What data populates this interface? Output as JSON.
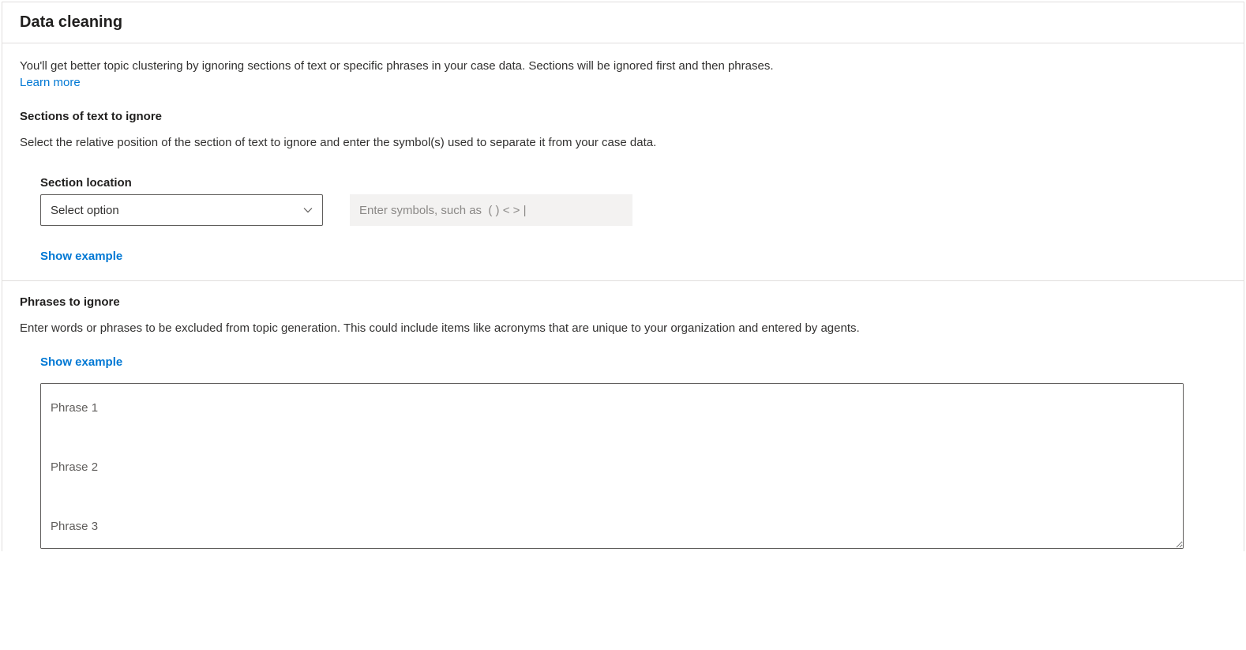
{
  "header": {
    "title": "Data cleaning"
  },
  "intro": {
    "text": "You'll get better topic clustering by ignoring sections of text or specific phrases in your case data. Sections will be ignored first and then phrases.",
    "learn_more": "Learn more"
  },
  "sections_block": {
    "heading": "Sections of text to ignore",
    "description": "Select the relative position of the section of text to ignore and enter the symbol(s) used to separate it from your case data.",
    "field_label": "Section location",
    "select_placeholder": "Select option",
    "symbols_placeholder": "Enter symbols, such as  ( ) < > |",
    "show_example": "Show example"
  },
  "phrases_block": {
    "heading": "Phrases to ignore",
    "description": "Enter words or phrases to be excluded from topic generation. This could include items like acronyms that are unique to your organization and entered by agents.",
    "show_example": "Show example",
    "textarea_placeholder": "Phrase 1\n\nPhrase 2\n\nPhrase 3"
  }
}
